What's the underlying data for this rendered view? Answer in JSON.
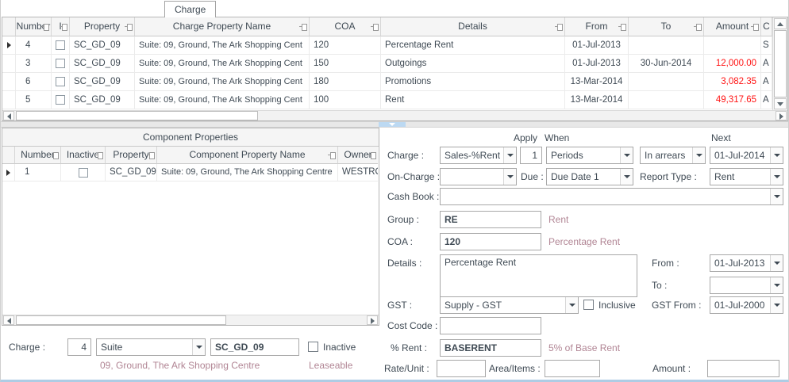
{
  "colors": {
    "text": "#3f4a54",
    "hint": "#b18594",
    "negative_amount": "#ff1414",
    "splitter_grip": "#bcd9f2",
    "window_bottom_edge": "#aecce4"
  },
  "tab": {
    "label": "Charge"
  },
  "charges_grid": {
    "headers": {
      "number": "Number",
      "inactive": "I",
      "property": "Property",
      "name": "Charge Property Name",
      "coa": "COA",
      "details": "Details",
      "from": "From",
      "to": "To",
      "amount": "Amount",
      "extra": "C"
    },
    "rows": [
      {
        "number": "4",
        "property": "SC_GD_09",
        "name": "Suite: 09, Ground, The Ark Shopping Cent",
        "coa": "120",
        "details": "Percentage Rent",
        "from": "01-Jul-2013",
        "to": "",
        "amount": "",
        "extra": "S"
      },
      {
        "number": "3",
        "property": "SC_GD_09",
        "name": "Suite: 09, Ground, The Ark Shopping Cent",
        "coa": "150",
        "details": "Outgoings",
        "from": "01-Jul-2013",
        "to": "30-Jun-2014",
        "amount": "12,000.00",
        "extra": "A"
      },
      {
        "number": "6",
        "property": "SC_GD_09",
        "name": "Suite: 09, Ground, The Ark Shopping Cent",
        "coa": "180",
        "details": "Promotions",
        "from": "13-Mar-2014",
        "to": "",
        "amount": "3,082.35",
        "extra": "A"
      },
      {
        "number": "5",
        "property": "SC_GD_09",
        "name": "Suite: 09, Ground, The Ark Shopping Cent",
        "coa": "100",
        "details": "Rent",
        "from": "13-Mar-2014",
        "to": "",
        "amount": "49,317.65",
        "extra": "A"
      }
    ]
  },
  "component_grid": {
    "band_title": "Component Properties",
    "headers": {
      "number": "Number",
      "inactive": "Inactive",
      "property": "Property",
      "name": "Component Property Name",
      "owner": "Owner"
    },
    "rows": [
      {
        "number": "1",
        "property": "SC_GD_09",
        "name": "Suite: 09, Ground, The Ark Shopping Centre",
        "owner": "WESTRO"
      }
    ]
  },
  "footer": {
    "charge_label": "Charge :",
    "charge_number": "4",
    "type_value": "Suite",
    "property_code": "SC_GD_09",
    "inactive_label": "Inactive",
    "property_hint": "09, Ground, The Ark Shopping Centre",
    "leaseable_hint": "Leaseable"
  },
  "form": {
    "apply_header": "Apply",
    "when_header": "When",
    "next_header": "Next",
    "charge_label": "Charge :",
    "charge_value": "Sales-%Rent",
    "apply_value": "1",
    "when_value": "Periods",
    "arrears_value": "In arrears",
    "next_value": "01-Jul-2014",
    "oncharge_label": "On-Charge :",
    "oncharge_value": "",
    "due_label": "Due :",
    "due_value": "Due Date 1",
    "report_type_label": "Report Type :",
    "report_type_value": "Rent",
    "cashbook_label": "Cash Book :",
    "cashbook_value": "",
    "group_label": "Group :",
    "group_value": "RE",
    "group_hint": "Rent",
    "coa_label": "COA :",
    "coa_value": "120",
    "coa_hint": "Percentage Rent",
    "details_label": "Details :",
    "details_value": "Percentage Rent",
    "from_label": "From :",
    "from_value": "01-Jul-2013",
    "to_label": "To :",
    "to_value": "",
    "gst_label": "GST :",
    "gst_value": "Supply - GST",
    "inclusive_label": "Inclusive",
    "gst_from_label": "GST From :",
    "gst_from_value": "01-Jul-2000",
    "cost_code_label": "Cost Code :",
    "cost_code_value": "",
    "pct_rent_label": "% Rent :",
    "pct_rent_value": "BASERENT",
    "pct_rent_hint": "5% of Base Rent",
    "rate_unit_label": "Rate/Unit :",
    "rate_unit_value": "",
    "area_items_label": "Area/Items :",
    "area_items_value": "",
    "amount_label": "Amount :",
    "amount_value": ""
  }
}
